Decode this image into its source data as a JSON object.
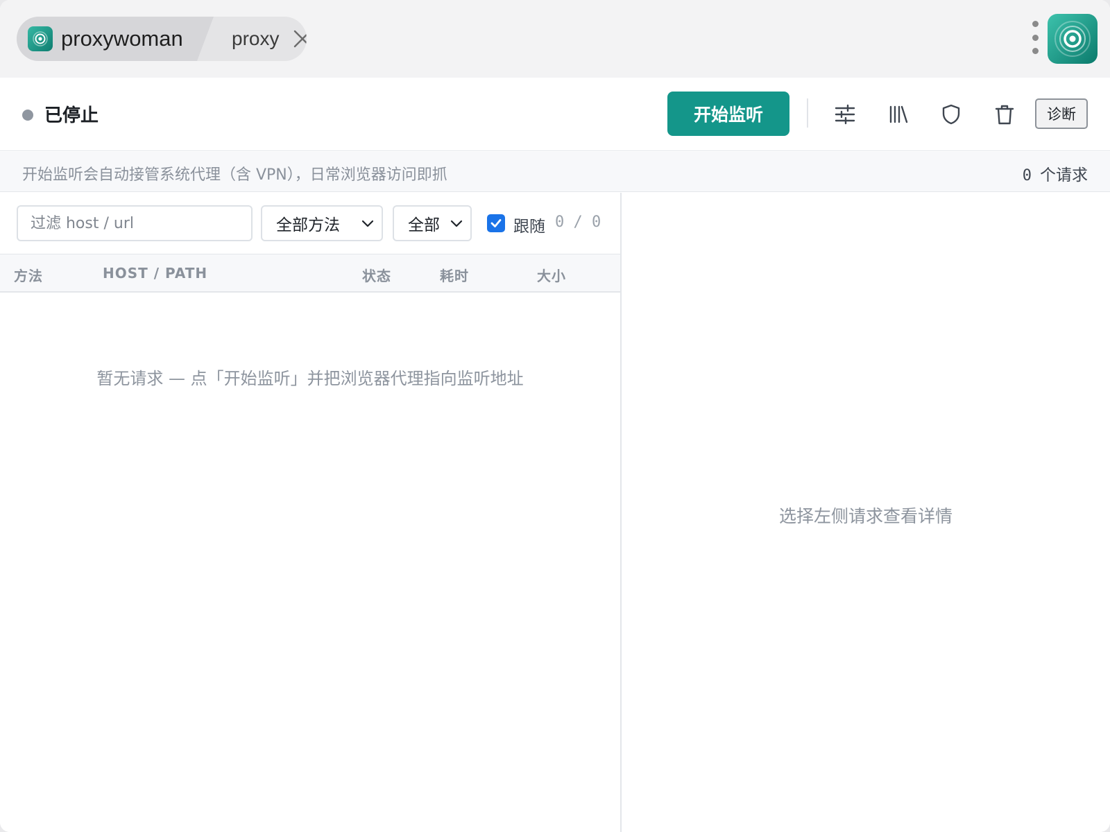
{
  "window": {
    "tabs": [
      {
        "label": "proxywoman",
        "active": true
      },
      {
        "label": "proxy",
        "active": false
      }
    ]
  },
  "toolbar": {
    "status": "已停止",
    "start_label": "开始监听",
    "icons": [
      "sliders-icon",
      "library-icon",
      "shield-icon",
      "trash-icon"
    ],
    "diagnose_label": "诊断",
    "accent_color": "#14968a"
  },
  "infobar": {
    "hint": "开始监听会自动接管系统代理（含 VPN），日常浏览器访问即抓",
    "count": "0",
    "count_unit": "个请求"
  },
  "filters": {
    "search_placeholder": "过滤 host / url",
    "method_selected": "全部方法",
    "status_selected": "全部",
    "follow_label": "跟随",
    "follow_checked": true,
    "follow_count": "0 / 0"
  },
  "table": {
    "columns": [
      "方法",
      "HOST / PATH",
      "状态",
      "耗时",
      "大小"
    ],
    "rows": [],
    "empty_message": "暂无请求 — 点「开始监听」并把浏览器代理指向监听地址"
  },
  "detail": {
    "empty_message": "选择左侧请求查看详情"
  }
}
